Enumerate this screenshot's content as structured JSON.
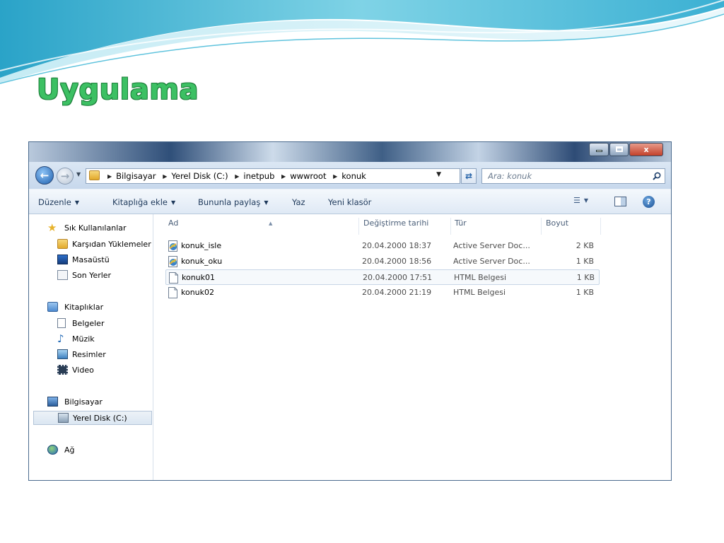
{
  "slide": {
    "title": "Uygulama"
  },
  "window": {
    "controls": {
      "minimize": "",
      "maximize": "",
      "close": "x"
    }
  },
  "navigation": {
    "breadcrumbs": [
      "Bilgisayar",
      "Yerel Disk (C:)",
      "inetpub",
      "wwwroot",
      "konuk"
    ],
    "search_placeholder": "Ara: konuk"
  },
  "toolbar": {
    "organize": "Düzenle",
    "add_to_library": "Kitaplığa ekle",
    "share_with": "Bununla paylaş",
    "burn": "Yaz",
    "new_folder": "Yeni klasör"
  },
  "sidebar": {
    "favorites_header": "Sık Kullanılanlar",
    "favorites": [
      "Karşıdan Yüklemeler",
      "Masaüstü",
      "Son Yerler"
    ],
    "libraries_header": "Kitaplıklar",
    "libraries": [
      "Belgeler",
      "Müzik",
      "Resimler",
      "Video"
    ],
    "computer_header": "Bilgisayar",
    "computer_items": [
      "Yerel Disk (C:)"
    ],
    "network_header": "Ağ"
  },
  "file_list": {
    "columns": [
      "Ad",
      "Değiştirme tarihi",
      "Tür",
      "Boyut"
    ],
    "rows": [
      {
        "name": "konuk_isle",
        "date": "20.04.2000 18:37",
        "type": "Active Server Doc...",
        "size": "2 KB",
        "icon": "asp-file-icon"
      },
      {
        "name": "konuk_oku",
        "date": "20.04.2000 18:56",
        "type": "Active Server Doc...",
        "size": "1 KB",
        "icon": "asp-file-icon"
      },
      {
        "name": "konuk01",
        "date": "20.04.2000 17:51",
        "type": "HTML Belgesi",
        "size": "1 KB",
        "icon": "html-file-icon"
      },
      {
        "name": "konuk02",
        "date": "20.04.2000 21:19",
        "type": "HTML Belgesi",
        "size": "1 KB",
        "icon": "html-file-icon"
      }
    ]
  },
  "colors": {
    "title_green": "#3cc063",
    "toolbar_text": "#1e395b",
    "window_border": "#4b6b8e"
  }
}
